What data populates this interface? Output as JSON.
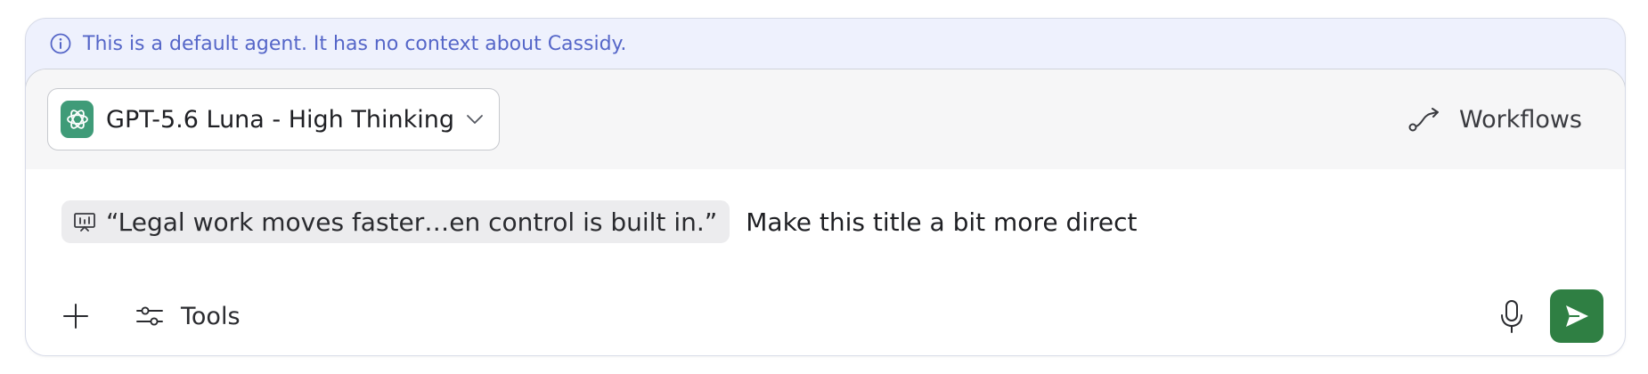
{
  "notice": {
    "text": "This is a default agent. It has no context about Cassidy.",
    "icon": "info-icon"
  },
  "model_selector": {
    "label": "GPT-5.6 Luna - High Thinking",
    "logo_icon": "openai-logo-icon",
    "dropdown_icon": "chevron-down-icon"
  },
  "workflows": {
    "label": "Workflows",
    "icon": "workflow-icon"
  },
  "input": {
    "context_chip": {
      "text": "“Legal work moves faster…en control is built in.”",
      "icon": "presentation-icon"
    },
    "message": "Make this title a bit more direct"
  },
  "bottom_toolbar": {
    "add_icon": "plus-icon",
    "tools_label": "Tools",
    "tools_icon": "sliders-icon",
    "mic_icon": "microphone-icon",
    "send_icon": "send-icon"
  },
  "colors": {
    "notice_bg": "#eef1fd",
    "notice_text": "#5566c8",
    "logo_bg": "#3f9b78",
    "send_bg": "#2f7f43",
    "chip_bg": "#ececee"
  }
}
